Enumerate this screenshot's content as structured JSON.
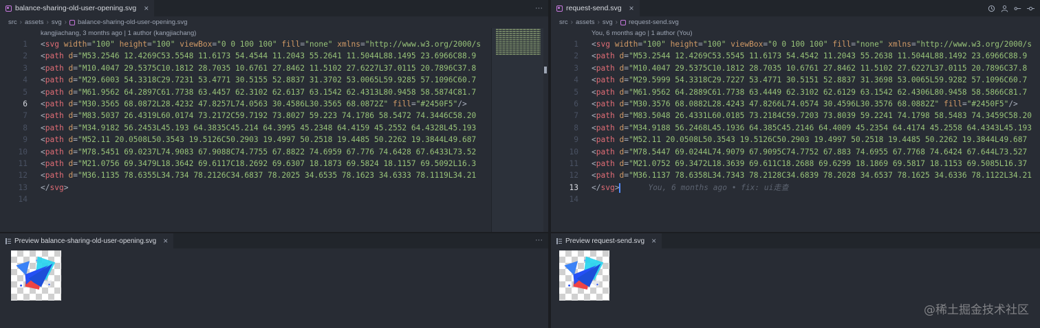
{
  "colors": {
    "accent": "#528bff",
    "preview_fill": "#2450F5"
  },
  "left": {
    "tab_title": "balance-sharing-old-user-opening.svg",
    "close_glyph": "×",
    "more_glyph": "···",
    "breadcrumb": [
      "src",
      "assets",
      "svg",
      "balance-sharing-old-user-opening.svg"
    ],
    "blame_header": "kangjiachang, 3 months ago | 1 author (kangjiachang)",
    "lines": [
      "<svg width=\"100\" height=\"100\" viewBox=\"0 0 100 100\" fill=\"none\" xmlns=\"http://www.w3.org/2000/s",
      "<path d=\"M53.2546 12.4269C53.5548 11.6173 54.4544 11.2043 55.2641 11.5044L88.1495 23.6966C88.9",
      "<path d=\"M10.4047 29.5375C10.1812 28.7035 10.6761 27.8462 11.5102 27.6227L37.0115 20.7896C37.8",
      "<path d=\"M29.6003 54.3318C29.7231 53.4771 30.5155 52.8837 31.3702 53.0065L59.9285 57.1096C60.7",
      "<path d=\"M61.9562 64.2897C61.7738 63.4457 62.3102 62.6137 63.1542 62.4313L80.9458 58.5874C81.7",
      "<path d=\"M30.3565 68.0872L28.4232 47.8257L74.0563 30.4586L30.3565 68.0872Z\" fill=\"#2450F5\"/>",
      "<path d=\"M83.5037 26.4319L60.0174 73.2172C59.7192 73.8027 59.223 74.1786 58.5472 74.3446C58.20",
      "<path d=\"M34.9182 56.2453L45.193 64.3835C45.214 64.3995 45.2348 64.4159 45.2552 64.4328L45.193",
      "<path d=\"M52.11 20.0508L50.3543 19.5126C50.2903 19.4997 50.2518 19.4485 50.2262 19.3844L49.687",
      "<path d=\"M78.5451 69.0237L74.9083 67.9088C74.7755 67.8822 74.6959 67.776 74.6428 67.6433L73.52",
      "<path d=\"M21.0756 69.3479L18.3642 69.6117C18.2692 69.6307 18.1873 69.5824 18.1157 69.5092L16.3",
      "<path d=\"M36.1135 78.6355L34.734 78.2126C34.6837 78.2025 34.6535 78.1623 34.6333 78.1119L34.21",
      "</svg>",
      ""
    ],
    "active_line": 6,
    "preview_tab": "Preview balance-sharing-old-user-opening.svg"
  },
  "right": {
    "tab_title": "request-send.svg",
    "breadcrumb": [
      "src",
      "assets",
      "svg",
      "request-send.svg"
    ],
    "blame_header": "You, 6 months ago | 1 author (You)",
    "lines": [
      "<svg width=\"100\" height=\"100\" viewBox=\"0 0 100 100\" fill=\"none\" xmlns=\"http://www.w3.org/2000/s",
      "<path d=\"M53.2544 12.4269C53.5545 11.6173 54.4542 11.2043 55.2638 11.5044L88.1492 23.6966C88.9",
      "<path d=\"M10.4047 29.5375C10.1812 28.7035 10.6761 27.8462 11.5102 27.6227L37.0115 20.7896C37.8",
      "<path d=\"M29.5999 54.3318C29.7227 53.4771 30.5151 52.8837 31.3698 53.0065L59.9282 57.1096C60.7",
      "<path d=\"M61.9562 64.2889C61.7738 63.4449 62.3102 62.6129 63.1542 62.4306L80.9458 58.5866C81.7",
      "<path d=\"M30.3576 68.0882L28.4243 47.8266L74.0574 30.4596L30.3576 68.0882Z\" fill=\"#2450F5\"/>",
      "<path d=\"M83.5048 26.4331L60.0185 73.2184C59.7203 73.8039 59.2241 74.1798 58.5483 74.3459C58.20",
      "<path d=\"M34.9188 56.2468L45.1936 64.385C45.2146 64.4009 45.2354 64.4174 45.2558 64.4343L45.193",
      "<path d=\"M52.11 20.0508L50.3543 19.5126C50.2903 19.4997 50.2518 19.4485 50.2262 19.3844L49.687",
      "<path d=\"M78.5447 69.0244L74.9079 67.9095C74.7752 67.883 74.6955 67.7768 74.6424 67.644L73.527",
      "<path d=\"M21.0752 69.3472L18.3639 69.611C18.2688 69.6299 18.1869 69.5817 18.1153 69.5085L16.37",
      "<path d=\"M36.1137 78.6358L34.7343 78.2128C34.6839 78.2028 34.6537 78.1625 34.6336 78.1122L34.21",
      "</svg>",
      ""
    ],
    "active_line": 13,
    "inline_blame": "You, 6 months ago • fix: ui走查",
    "preview_tab": "Preview request-send.svg",
    "toolbar_icons": [
      "history-icon",
      "account-icon",
      "git-compare-icon",
      "git-commit-icon"
    ]
  },
  "watermark": "@稀土掘金技术社区"
}
